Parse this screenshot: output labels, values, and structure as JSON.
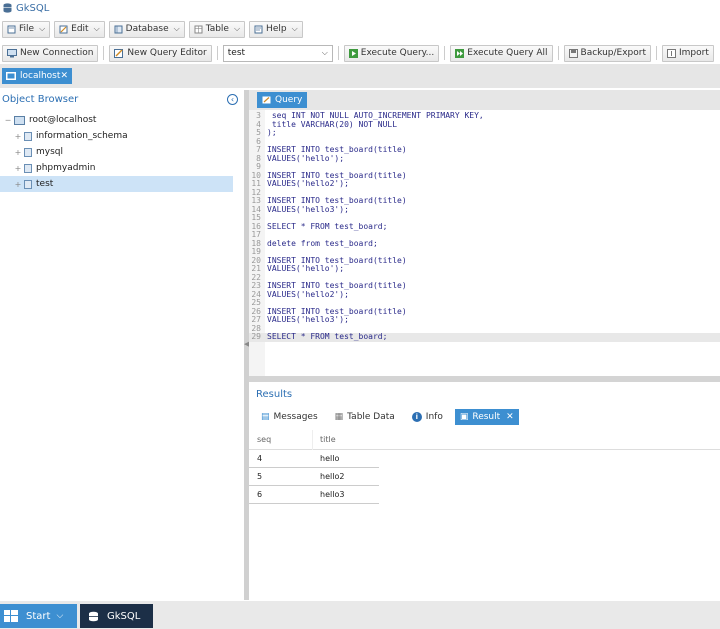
{
  "window": {
    "title": "GkSQL"
  },
  "menu": [
    {
      "label": "File"
    },
    {
      "label": "Edit"
    },
    {
      "label": "Database"
    },
    {
      "label": "Table"
    },
    {
      "label": "Help"
    }
  ],
  "toolbar": {
    "new_connection": "New Connection",
    "new_query_editor": "New Query Editor",
    "db_select_value": "test",
    "execute_query": "Execute Query...",
    "execute_query_all": "Execute Query All",
    "backup_export": "Backup/Export",
    "import": "Import"
  },
  "connection_tab": {
    "label": "localhost"
  },
  "object_browser": {
    "title": "Object Browser",
    "root": "root@localhost",
    "databases": [
      "information_schema",
      "mysql",
      "phpmyadmin",
      "test"
    ],
    "selected": "test"
  },
  "query_tab": {
    "label": "Query"
  },
  "editor": {
    "lines": [
      {
        "n": "3",
        "text": " seq INT NOT NULL AUTO_INCREMENT PRIMARY KEY,"
      },
      {
        "n": "4",
        "text": " title VARCHAR(20) NOT NULL"
      },
      {
        "n": "5",
        "text": ");"
      },
      {
        "n": "6",
        "text": ""
      },
      {
        "n": "7",
        "text": "INSERT INTO test_board(title)"
      },
      {
        "n": "8",
        "text": "VALUES('hello');"
      },
      {
        "n": "9",
        "text": ""
      },
      {
        "n": "10",
        "text": "INSERT INTO test_board(title)"
      },
      {
        "n": "11",
        "text": "VALUES('hello2');"
      },
      {
        "n": "12",
        "text": ""
      },
      {
        "n": "13",
        "text": "INSERT INTO test_board(title)"
      },
      {
        "n": "14",
        "text": "VALUES('hello3');"
      },
      {
        "n": "15",
        "text": ""
      },
      {
        "n": "16",
        "text": "SELECT * FROM test_board;"
      },
      {
        "n": "17",
        "text": ""
      },
      {
        "n": "18",
        "text": "delete from test_board;"
      },
      {
        "n": "19",
        "text": ""
      },
      {
        "n": "20",
        "text": "INSERT INTO test_board(title)"
      },
      {
        "n": "21",
        "text": "VALUES('hello');"
      },
      {
        "n": "22",
        "text": ""
      },
      {
        "n": "23",
        "text": "INSERT INTO test_board(title)"
      },
      {
        "n": "24",
        "text": "VALUES('hello2');"
      },
      {
        "n": "25",
        "text": ""
      },
      {
        "n": "26",
        "text": "INSERT INTO test_board(title)"
      },
      {
        "n": "27",
        "text": "VALUES('hello3');"
      },
      {
        "n": "28",
        "text": ""
      },
      {
        "n": "29",
        "text": "SELECT * FROM test_board;"
      }
    ],
    "highlight_line": "29"
  },
  "results": {
    "title": "Results",
    "tabs": [
      "Messages",
      "Table Data",
      "Info",
      "Result"
    ],
    "active_tab": "Result",
    "columns": [
      "seq",
      "title"
    ],
    "rows": [
      [
        "4",
        "hello"
      ],
      [
        "5",
        "hello2"
      ],
      [
        "6",
        "hello3"
      ]
    ]
  },
  "taskbar": {
    "start": "Start",
    "app": "GkSQL"
  },
  "colors": {
    "accent": "#3d8fd1",
    "title_blue": "#2c6fb3",
    "taskbar_app": "#1c2f47"
  }
}
